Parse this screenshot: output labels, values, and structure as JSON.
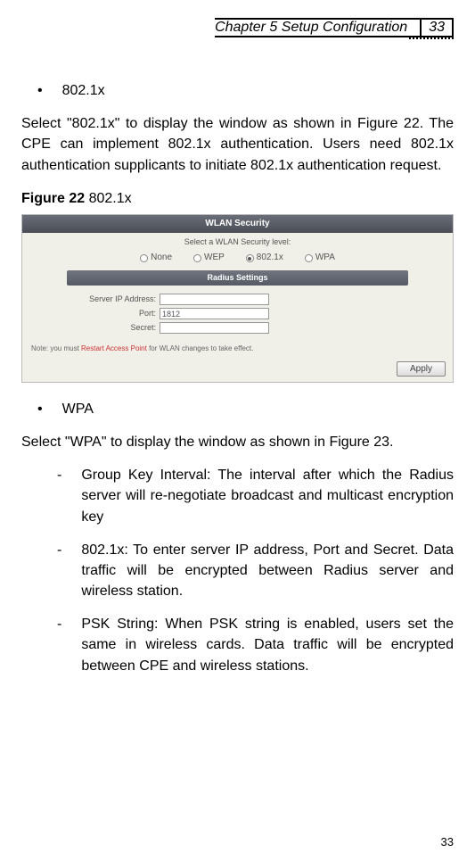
{
  "header": {
    "chapter": "Chapter 5 Setup Configuration",
    "pageTop": "33"
  },
  "sections": {
    "bullet1": "802.1x",
    "para1": "Select \"802.1x\" to display the window as shown in Figure 22. The CPE can implement 802.1x authentication. Users need 802.1x authentication supplicants to initiate 802.1x authentication request.",
    "figLabelBold": "Figure 22",
    "figLabelRest": " 802.1x",
    "bullet2": "WPA",
    "para2": "Select \"WPA\" to display the window as shown in Figure 23.",
    "dash1": "Group Key Interval: The interval after which the Radius server will re-negotiate broadcast and multicast encryption key",
    "dash2": "802.1x: To enter server IP address, Port and Secret. Data traffic will be encrypted between Radius server and wireless station.",
    "dash3": "PSK String: When PSK string is enabled, users set the same in wireless cards. Data traffic will be encrypted between CPE and wireless stations."
  },
  "figure": {
    "title": "WLAN Security",
    "subhead": "Select a WLAN Security level:",
    "radios": {
      "none": "None",
      "wep": "WEP",
      "dot1x": "802.1x",
      "wpa": "WPA"
    },
    "radiusTitle": "Radius Settings",
    "labels": {
      "server": "Server IP Address:",
      "port": "Port:",
      "secret": "Secret:"
    },
    "values": {
      "server": "",
      "port": "1812",
      "secret": ""
    },
    "notePrefix": "Note: you must ",
    "noteRed": "Restart Access Point",
    "noteSuffix": " for WLAN changes to take effect.",
    "applyLabel": "Apply"
  },
  "footer": {
    "pageBottom": "33"
  }
}
